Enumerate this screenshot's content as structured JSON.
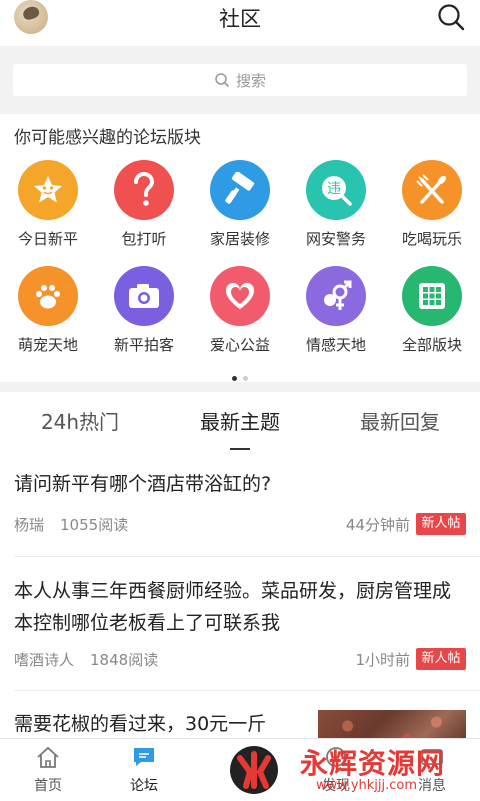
{
  "header": {
    "title": "社区"
  },
  "search": {
    "placeholder": "搜索"
  },
  "section": {
    "title": "你可能感兴趣的论坛版块"
  },
  "forums": [
    {
      "label": "今日新平",
      "color": "#f4a62a",
      "icon": "star-icon"
    },
    {
      "label": "包打听",
      "color": "#f0504f",
      "icon": "question-icon"
    },
    {
      "label": "家居装修",
      "color": "#2f9be5",
      "icon": "paint-roller-icon"
    },
    {
      "label": "网安警务",
      "color": "#29c4b0",
      "icon": "police-badge-icon"
    },
    {
      "label": "吃喝玩乐",
      "color": "#f6922a",
      "icon": "fork-knife-icon"
    },
    {
      "label": "萌宠天地",
      "color": "#f6922a",
      "icon": "paw-icon"
    },
    {
      "label": "新平拍客",
      "color": "#7a5fe0",
      "icon": "camera-icon"
    },
    {
      "label": "爱心公益",
      "color": "#f15b6c",
      "icon": "heart-icon"
    },
    {
      "label": "情感天地",
      "color": "#8b6ae0",
      "icon": "gender-icon"
    },
    {
      "label": "全部版块",
      "color": "#27b770",
      "icon": "grid-icon"
    }
  ],
  "tabs": [
    {
      "label": "24h热门"
    },
    {
      "label": "最新主题"
    },
    {
      "label": "最新回复"
    }
  ],
  "active_tab": "最新主题",
  "posts": [
    {
      "title": "请问新平有哪个酒店带浴缸的?",
      "author": "杨瑞",
      "reads": "1055阅读",
      "time": "44分钟前",
      "badge": "新人帖"
    },
    {
      "title": "本人从事三年西餐厨师经验。菜品研发，厨房管理成本控制哪位老板看上了可联系我",
      "author": "嗜酒诗人",
      "reads": "1848阅读",
      "time": "1小时前",
      "badge": "新人帖"
    },
    {
      "title": "需要花椒的看过来，30元一斤"
    }
  ],
  "nav": [
    {
      "label": "首页",
      "icon": "home-icon"
    },
    {
      "label": "论坛",
      "icon": "chat-icon"
    },
    {
      "label": "发现",
      "icon": "compass-icon"
    },
    {
      "label": "消息",
      "icon": "message-icon"
    }
  ],
  "watermark": {
    "text": "永辉资源网",
    "url": "www.yhkjjj.com"
  }
}
